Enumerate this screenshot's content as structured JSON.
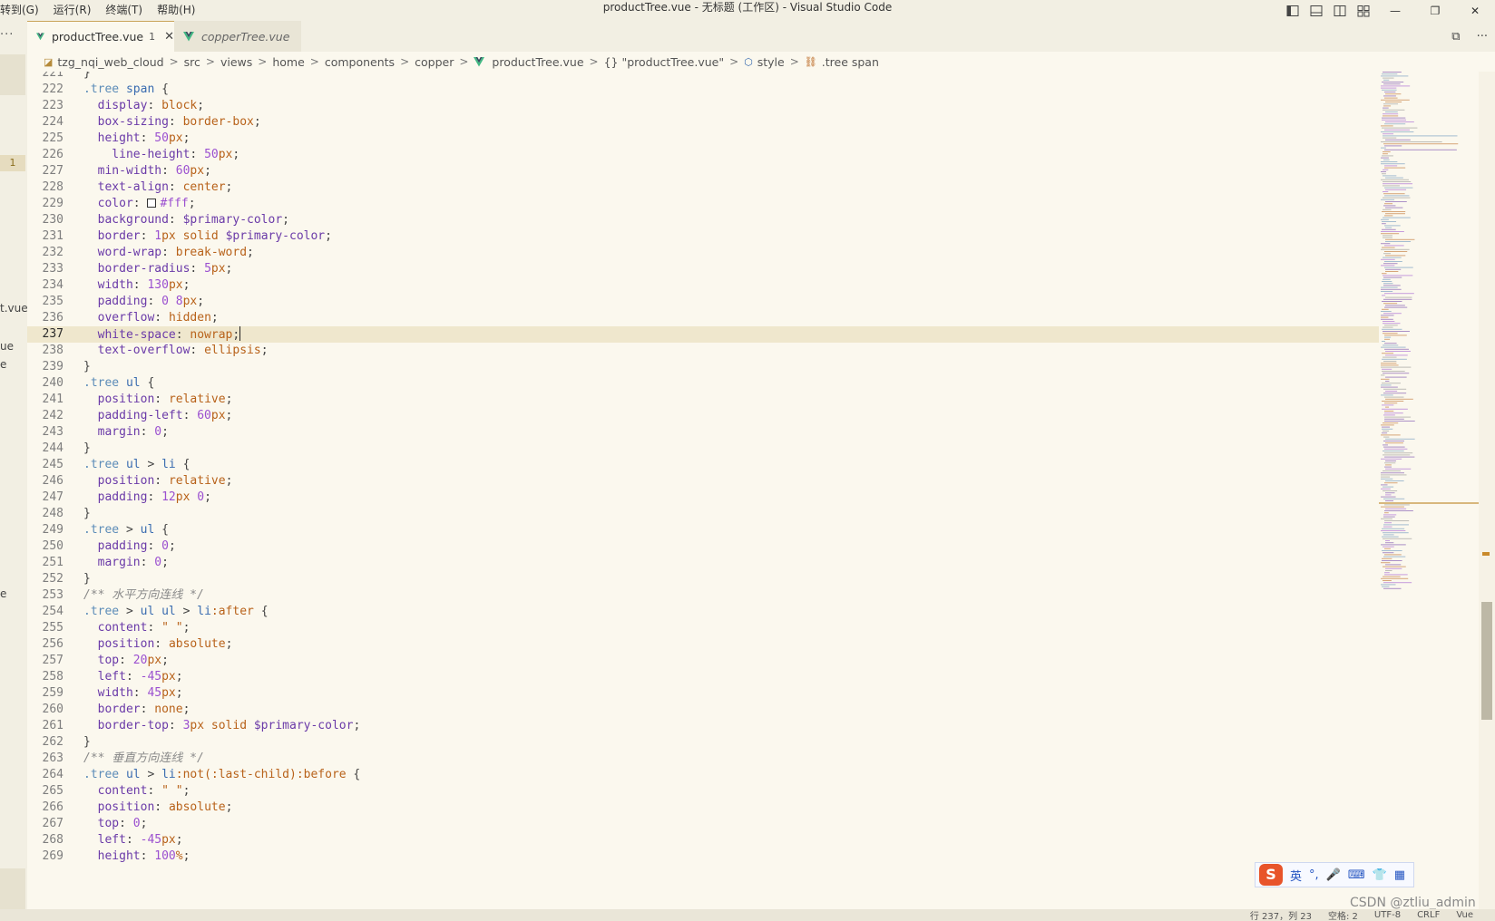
{
  "menu": [
    "转到(G)",
    "运行(R)",
    "终端(T)",
    "帮助(H)"
  ],
  "window_title": "productTree.vue - 无标题 (工作区) - Visual Studio Code",
  "window_controls": {
    "minimize": "—",
    "maximize": "❐",
    "close": "✕"
  },
  "sidebar": {
    "more": "···",
    "problem_badge": "1",
    "fragments": [
      "t.vue",
      "ue",
      "e",
      "e"
    ]
  },
  "tabs": [
    {
      "label": "productTree.vue",
      "modified": "1",
      "close": "✕",
      "active": true
    },
    {
      "label": "copperTree.vue",
      "active": false
    }
  ],
  "tab_actions": {
    "split": "⧉",
    "more": "···"
  },
  "breadcrumb": [
    "tzg_nqi_web_cloud",
    "src",
    "views",
    "home",
    "components",
    "copper",
    "productTree.vue",
    "{} \"productTree.vue\"",
    "style",
    ".tree span"
  ],
  "editor": {
    "current_line": 237,
    "lines": [
      {
        "n": "221",
        "tokens": [
          [
            "}",
            "punc"
          ]
        ]
      },
      {
        "n": "222",
        "tokens": [
          [
            ".tree ",
            "sel"
          ],
          [
            "span",
            "tag"
          ],
          [
            " {",
            "punc"
          ]
        ]
      },
      {
        "n": "223",
        "tokens": [
          [
            "  display",
            "prop"
          ],
          [
            ": ",
            "punc"
          ],
          [
            "block",
            "val"
          ],
          [
            ";",
            "punc"
          ]
        ]
      },
      {
        "n": "224",
        "tokens": [
          [
            "  box-sizing",
            "prop"
          ],
          [
            ": ",
            "punc"
          ],
          [
            "border-box",
            "val"
          ],
          [
            ";",
            "punc"
          ]
        ]
      },
      {
        "n": "225",
        "tokens": [
          [
            "  height",
            "prop"
          ],
          [
            ": ",
            "punc"
          ],
          [
            "50",
            "num"
          ],
          [
            "px",
            "unit"
          ],
          [
            ";",
            "punc"
          ]
        ]
      },
      {
        "n": "226",
        "tokens": [
          [
            "    line-height",
            "prop"
          ],
          [
            ": ",
            "punc"
          ],
          [
            "50",
            "num"
          ],
          [
            "px",
            "unit"
          ],
          [
            ";",
            "punc"
          ]
        ]
      },
      {
        "n": "227",
        "tokens": [
          [
            "  min-width",
            "prop"
          ],
          [
            ": ",
            "punc"
          ],
          [
            "60",
            "num"
          ],
          [
            "px",
            "unit"
          ],
          [
            ";",
            "punc"
          ]
        ]
      },
      {
        "n": "228",
        "tokens": [
          [
            "  text-align",
            "prop"
          ],
          [
            ": ",
            "punc"
          ],
          [
            "center",
            "val"
          ],
          [
            ";",
            "punc"
          ]
        ]
      },
      {
        "n": "229",
        "tokens": [
          [
            "  color",
            "prop"
          ],
          [
            ": ",
            "punc"
          ],
          [
            "",
            "swatch"
          ],
          [
            "#fff",
            "num"
          ],
          [
            ";",
            "punc"
          ]
        ]
      },
      {
        "n": "230",
        "tokens": [
          [
            "  background",
            "prop"
          ],
          [
            ": ",
            "punc"
          ],
          [
            "$primary-color",
            "var"
          ],
          [
            ";",
            "punc"
          ]
        ]
      },
      {
        "n": "231",
        "tokens": [
          [
            "  border",
            "prop"
          ],
          [
            ": ",
            "punc"
          ],
          [
            "1",
            "num"
          ],
          [
            "px",
            "unit"
          ],
          [
            " solid ",
            "val"
          ],
          [
            "$primary-color",
            "var"
          ],
          [
            ";",
            "punc"
          ]
        ]
      },
      {
        "n": "232",
        "tokens": [
          [
            "  word-wrap",
            "prop"
          ],
          [
            ": ",
            "punc"
          ],
          [
            "break-word",
            "val"
          ],
          [
            ";",
            "punc"
          ]
        ]
      },
      {
        "n": "233",
        "tokens": [
          [
            "  border-radius",
            "prop"
          ],
          [
            ": ",
            "punc"
          ],
          [
            "5",
            "num"
          ],
          [
            "px",
            "unit"
          ],
          [
            ";",
            "punc"
          ]
        ]
      },
      {
        "n": "234",
        "tokens": [
          [
            "  width",
            "prop"
          ],
          [
            ": ",
            "punc"
          ],
          [
            "130",
            "num"
          ],
          [
            "px",
            "unit"
          ],
          [
            ";",
            "punc"
          ]
        ]
      },
      {
        "n": "235",
        "tokens": [
          [
            "  padding",
            "prop"
          ],
          [
            ": ",
            "punc"
          ],
          [
            "0",
            "num"
          ],
          [
            " ",
            "punc"
          ],
          [
            "8",
            "num"
          ],
          [
            "px",
            "unit"
          ],
          [
            ";",
            "punc"
          ]
        ]
      },
      {
        "n": "236",
        "tokens": [
          [
            "  overflow",
            "prop"
          ],
          [
            ": ",
            "punc"
          ],
          [
            "hidden",
            "val"
          ],
          [
            ";",
            "punc"
          ]
        ]
      },
      {
        "n": "237",
        "tokens": [
          [
            "  white-space",
            "prop"
          ],
          [
            ": ",
            "punc"
          ],
          [
            "nowrap",
            "val"
          ],
          [
            ";",
            "punc"
          ],
          [
            "",
            "cursor"
          ]
        ]
      },
      {
        "n": "238",
        "tokens": [
          [
            "  text-overflow",
            "prop"
          ],
          [
            ": ",
            "punc"
          ],
          [
            "ellipsis",
            "val"
          ],
          [
            ";",
            "punc"
          ]
        ]
      },
      {
        "n": "239",
        "tokens": [
          [
            "}",
            "punc"
          ]
        ]
      },
      {
        "n": "240",
        "tokens": [
          [
            ".tree ",
            "sel"
          ],
          [
            "ul",
            "tag"
          ],
          [
            " {",
            "punc"
          ]
        ]
      },
      {
        "n": "241",
        "tokens": [
          [
            "  position",
            "prop"
          ],
          [
            ": ",
            "punc"
          ],
          [
            "relative",
            "val"
          ],
          [
            ";",
            "punc"
          ]
        ]
      },
      {
        "n": "242",
        "tokens": [
          [
            "  padding-left",
            "prop"
          ],
          [
            ": ",
            "punc"
          ],
          [
            "60",
            "num"
          ],
          [
            "px",
            "unit"
          ],
          [
            ";",
            "punc"
          ]
        ]
      },
      {
        "n": "243",
        "tokens": [
          [
            "  margin",
            "prop"
          ],
          [
            ": ",
            "punc"
          ],
          [
            "0",
            "num"
          ],
          [
            ";",
            "punc"
          ]
        ]
      },
      {
        "n": "244",
        "tokens": [
          [
            "}",
            "punc"
          ]
        ]
      },
      {
        "n": "245",
        "tokens": [
          [
            ".tree ",
            "sel"
          ],
          [
            "ul",
            "tag"
          ],
          [
            " > ",
            "punc"
          ],
          [
            "li",
            "tag"
          ],
          [
            " {",
            "punc"
          ]
        ]
      },
      {
        "n": "246",
        "tokens": [
          [
            "  position",
            "prop"
          ],
          [
            ": ",
            "punc"
          ],
          [
            "relative",
            "val"
          ],
          [
            ";",
            "punc"
          ]
        ]
      },
      {
        "n": "247",
        "tokens": [
          [
            "  padding",
            "prop"
          ],
          [
            ": ",
            "punc"
          ],
          [
            "12",
            "num"
          ],
          [
            "px",
            "unit"
          ],
          [
            " ",
            "punc"
          ],
          [
            "0",
            "num"
          ],
          [
            ";",
            "punc"
          ]
        ]
      },
      {
        "n": "248",
        "tokens": [
          [
            "}",
            "punc"
          ]
        ]
      },
      {
        "n": "249",
        "tokens": [
          [
            ".tree",
            "sel"
          ],
          [
            " > ",
            "punc"
          ],
          [
            "ul",
            "tag"
          ],
          [
            " {",
            "punc"
          ]
        ]
      },
      {
        "n": "250",
        "tokens": [
          [
            "  padding",
            "prop"
          ],
          [
            ": ",
            "punc"
          ],
          [
            "0",
            "num"
          ],
          [
            ";",
            "punc"
          ]
        ]
      },
      {
        "n": "251",
        "tokens": [
          [
            "  margin",
            "prop"
          ],
          [
            ": ",
            "punc"
          ],
          [
            "0",
            "num"
          ],
          [
            ";",
            "punc"
          ]
        ]
      },
      {
        "n": "252",
        "tokens": [
          [
            "}",
            "punc"
          ]
        ]
      },
      {
        "n": "253",
        "tokens": [
          [
            "/** 水平方向连线 */",
            "comment"
          ]
        ]
      },
      {
        "n": "254",
        "tokens": [
          [
            ".tree",
            "sel"
          ],
          [
            " > ",
            "punc"
          ],
          [
            "ul ul",
            "tag"
          ],
          [
            " > ",
            "punc"
          ],
          [
            "li",
            "tag"
          ],
          [
            ":after",
            "pseudo"
          ],
          [
            " {",
            "punc"
          ]
        ]
      },
      {
        "n": "255",
        "tokens": [
          [
            "  content",
            "prop"
          ],
          [
            ": ",
            "punc"
          ],
          [
            "\" \"",
            "val"
          ],
          [
            ";",
            "punc"
          ]
        ]
      },
      {
        "n": "256",
        "tokens": [
          [
            "  position",
            "prop"
          ],
          [
            ": ",
            "punc"
          ],
          [
            "absolute",
            "val"
          ],
          [
            ";",
            "punc"
          ]
        ]
      },
      {
        "n": "257",
        "tokens": [
          [
            "  top",
            "prop"
          ],
          [
            ": ",
            "punc"
          ],
          [
            "20",
            "num"
          ],
          [
            "px",
            "unit"
          ],
          [
            ";",
            "punc"
          ]
        ]
      },
      {
        "n": "258",
        "tokens": [
          [
            "  left",
            "prop"
          ],
          [
            ": ",
            "punc"
          ],
          [
            "-45",
            "num"
          ],
          [
            "px",
            "unit"
          ],
          [
            ";",
            "punc"
          ]
        ]
      },
      {
        "n": "259",
        "tokens": [
          [
            "  width",
            "prop"
          ],
          [
            ": ",
            "punc"
          ],
          [
            "45",
            "num"
          ],
          [
            "px",
            "unit"
          ],
          [
            ";",
            "punc"
          ]
        ]
      },
      {
        "n": "260",
        "tokens": [
          [
            "  border",
            "prop"
          ],
          [
            ": ",
            "punc"
          ],
          [
            "none",
            "val"
          ],
          [
            ";",
            "punc"
          ]
        ]
      },
      {
        "n": "261",
        "tokens": [
          [
            "  border-top",
            "prop"
          ],
          [
            ": ",
            "punc"
          ],
          [
            "3",
            "num"
          ],
          [
            "px",
            "unit"
          ],
          [
            " solid ",
            "val"
          ],
          [
            "$primary-color",
            "var"
          ],
          [
            ";",
            "punc"
          ]
        ]
      },
      {
        "n": "262",
        "tokens": [
          [
            "}",
            "punc"
          ]
        ]
      },
      {
        "n": "263",
        "tokens": [
          [
            "/** 垂直方向连线 */",
            "comment"
          ]
        ]
      },
      {
        "n": "264",
        "tokens": [
          [
            ".tree ",
            "sel"
          ],
          [
            "ul",
            "tag"
          ],
          [
            " > ",
            "punc"
          ],
          [
            "li",
            "tag"
          ],
          [
            ":not(:last-child):before",
            "pseudo"
          ],
          [
            " {",
            "punc"
          ]
        ]
      },
      {
        "n": "265",
        "tokens": [
          [
            "  content",
            "prop"
          ],
          [
            ": ",
            "punc"
          ],
          [
            "\" \"",
            "val"
          ],
          [
            ";",
            "punc"
          ]
        ]
      },
      {
        "n": "266",
        "tokens": [
          [
            "  position",
            "prop"
          ],
          [
            ": ",
            "punc"
          ],
          [
            "absolute",
            "val"
          ],
          [
            ";",
            "punc"
          ]
        ]
      },
      {
        "n": "267",
        "tokens": [
          [
            "  top",
            "prop"
          ],
          [
            ": ",
            "punc"
          ],
          [
            "0",
            "num"
          ],
          [
            ";",
            "punc"
          ]
        ]
      },
      {
        "n": "268",
        "tokens": [
          [
            "  left",
            "prop"
          ],
          [
            ": ",
            "punc"
          ],
          [
            "-45",
            "num"
          ],
          [
            "px",
            "unit"
          ],
          [
            ";",
            "punc"
          ]
        ]
      },
      {
        "n": "269",
        "tokens": [
          [
            "  height",
            "prop"
          ],
          [
            ": ",
            "punc"
          ],
          [
            "100",
            "num"
          ],
          [
            "%",
            "unit"
          ],
          [
            ";",
            "punc"
          ]
        ]
      }
    ]
  },
  "statusbar": [
    "行 237，列 23",
    "空格: 2",
    "UTF-8",
    "CRLF",
    "Vue"
  ],
  "ime": {
    "logo": "S",
    "lang": "英",
    "punct": "°,",
    "mic": "🎤",
    "keyboard": "⌨",
    "skin": "👕",
    "apps": "▦"
  },
  "watermark": "CSDN @ztliu_admin",
  "colors": {
    "accent": "#c9a45a",
    "background": "#fbf8ee",
    "current_line": "#efe7cd"
  }
}
